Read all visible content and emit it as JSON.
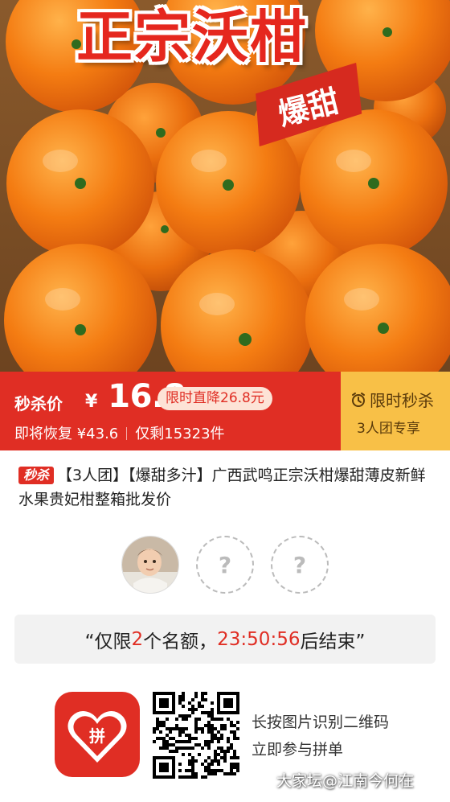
{
  "hero": {
    "title": "正宗沃柑",
    "tag": "爆甜"
  },
  "price": {
    "label": "秒杀价",
    "currency": "¥",
    "value": "16.8",
    "discount_tag": "限时直降26.8元",
    "restore_text": "即将恢复 ¥43.6",
    "stock_text": "仅剩15323件"
  },
  "flash_sale": {
    "title": "限时秒杀",
    "subtitle": "3人团专享"
  },
  "product": {
    "badge": "秒杀",
    "title": "【3人团】【爆甜多汁】广西武鸣正宗沃柑爆甜薄皮新鲜水果贵妃柑整箱批发价"
  },
  "group": {
    "empty_slot_symbol": "?"
  },
  "countdown": {
    "prefix": "“仅限",
    "count": "2",
    "middle": "个名额，",
    "time": "23:50:56",
    "suffix": "后结束”"
  },
  "footer": {
    "line1": "长按图片识别二维码",
    "line2": "立即参与拼单",
    "watermark": "大家坛@江南今何在"
  },
  "colors": {
    "brand_red": "#e02e24",
    "flash_yellow": "#f8c047",
    "discount_tag_bg": "#fde3d6",
    "countdown_bg": "#f2f2f2"
  },
  "icons": {
    "clock": "alarm-clock-icon",
    "app": "pinduoduo-app-icon",
    "qr": "qr-code"
  }
}
